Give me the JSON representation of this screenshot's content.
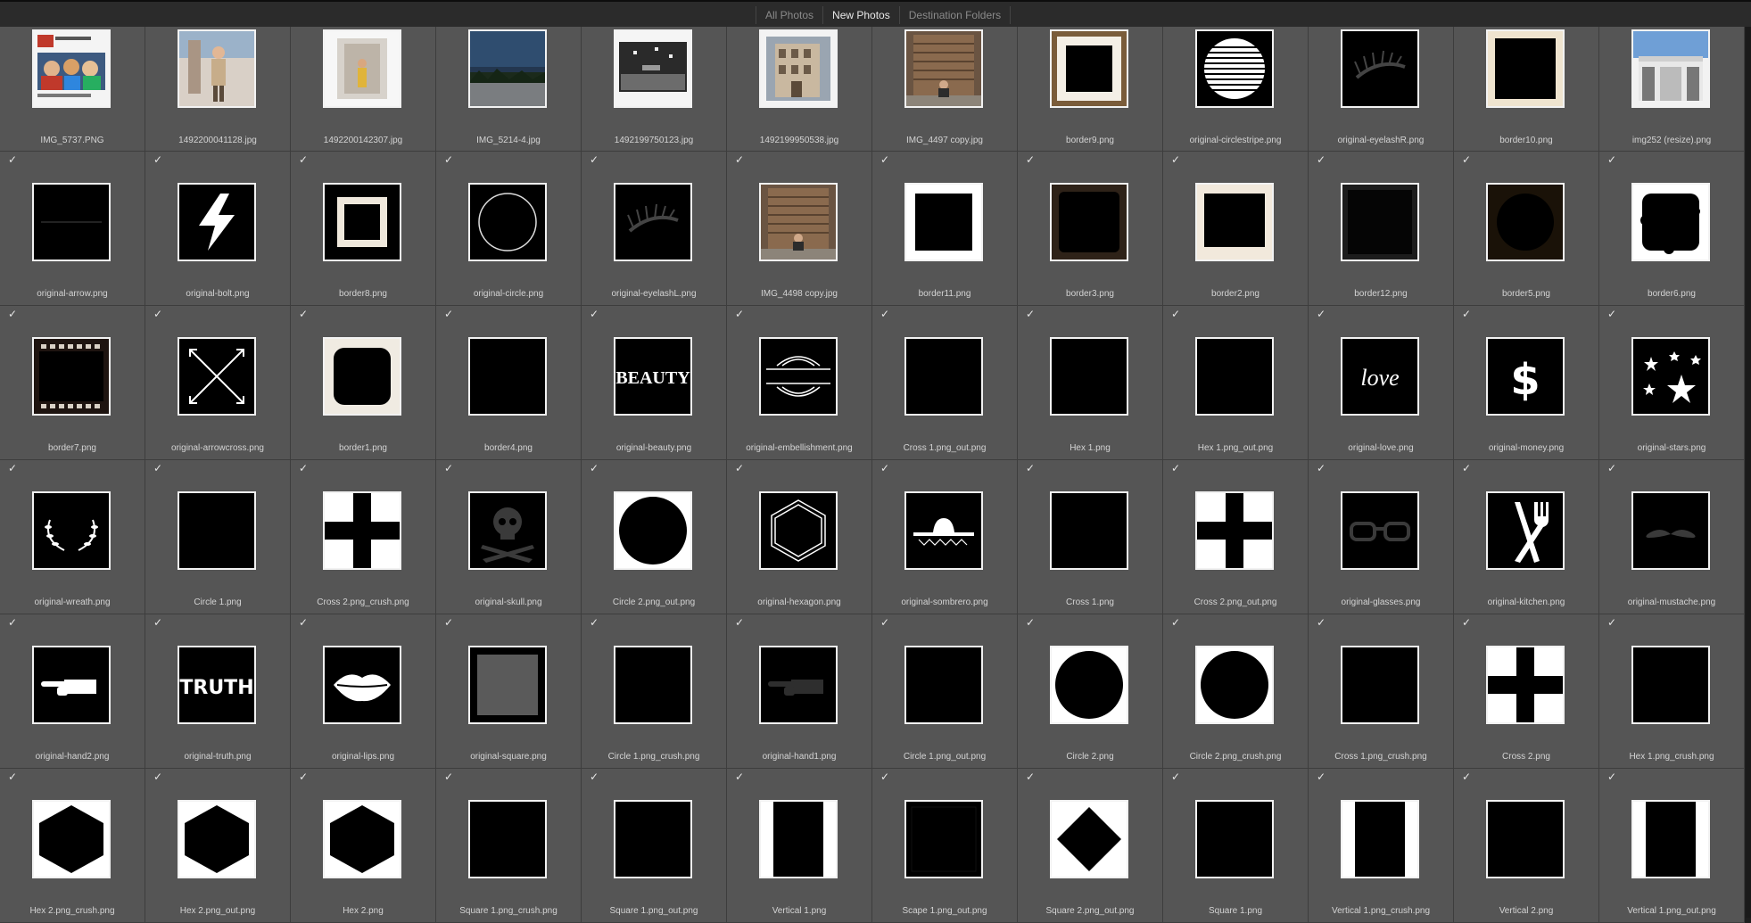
{
  "tabs": [
    "All Photos",
    "New Photos",
    "Destination Folders"
  ],
  "active_tab": "New Photos",
  "rows": [
    {
      "checked": false,
      "items": [
        {
          "name": "IMG_5737.PNG",
          "art": "photo-collage"
        },
        {
          "name": "1492200041128.jpg",
          "art": "photo-person"
        },
        {
          "name": "1492200142307.jpg",
          "art": "photo-door"
        },
        {
          "name": "IMG_5214-4.jpg",
          "art": "photo-landscape"
        },
        {
          "name": "1492199750123.jpg",
          "art": "photo-street"
        },
        {
          "name": "1492199950538.jpg",
          "art": "photo-building"
        },
        {
          "name": "IMG_4497 copy.jpg",
          "art": "photo-wood"
        },
        {
          "name": "border9.png",
          "art": "frame-wood"
        },
        {
          "name": "original-circlestripe.png",
          "art": "circle-stripe"
        },
        {
          "name": "original-eyelashR.png",
          "art": "eyelash"
        },
        {
          "name": "border10.png",
          "art": "frame-cream"
        },
        {
          "name": "img252 (resize).png",
          "art": "photo-building2"
        }
      ]
    },
    {
      "checked": true,
      "items": [
        {
          "name": "original-arrow.png",
          "art": "arrow-line"
        },
        {
          "name": "original-bolt.png",
          "art": "bolt"
        },
        {
          "name": "border8.png",
          "art": "frame-inner-square"
        },
        {
          "name": "original-circle.png",
          "art": "circle-outline"
        },
        {
          "name": "original-eyelashL.png",
          "art": "eyelash"
        },
        {
          "name": "IMG_4498 copy.jpg",
          "art": "photo-wood"
        },
        {
          "name": "border11.png",
          "art": "frame-white-thick"
        },
        {
          "name": "border3.png",
          "art": "frame-dark-brown"
        },
        {
          "name": "border2.png",
          "art": "frame-cream-thin"
        },
        {
          "name": "border12.png",
          "art": "frame-dark-gray"
        },
        {
          "name": "border5.png",
          "art": "frame-burnt"
        },
        {
          "name": "border6.png",
          "art": "frame-grunge"
        }
      ]
    },
    {
      "checked": true,
      "items": [
        {
          "name": "border7.png",
          "art": "frame-film"
        },
        {
          "name": "original-arrowcross.png",
          "art": "arrows-cross"
        },
        {
          "name": "border1.png",
          "art": "frame-rounded"
        },
        {
          "name": "border4.png",
          "art": "black"
        },
        {
          "name": "original-beauty.png",
          "art": "text-beauty"
        },
        {
          "name": "original-embellishment.png",
          "art": "embellishment"
        },
        {
          "name": "Cross 1.png_out.png",
          "art": "black"
        },
        {
          "name": "Hex 1.png",
          "art": "black"
        },
        {
          "name": "Hex 1.png_out.png",
          "art": "black"
        },
        {
          "name": "original-love.png",
          "art": "text-love"
        },
        {
          "name": "original-money.png",
          "art": "money"
        },
        {
          "name": "original-stars.png",
          "art": "stars"
        }
      ]
    },
    {
      "checked": true,
      "items": [
        {
          "name": "original-wreath.png",
          "art": "wreath"
        },
        {
          "name": "Circle 1.png",
          "art": "black"
        },
        {
          "name": "Cross 2.png_crush.png",
          "art": "cross-white"
        },
        {
          "name": "original-skull.png",
          "art": "skull"
        },
        {
          "name": "Circle 2.png_out.png",
          "art": "circle-black"
        },
        {
          "name": "original-hexagon.png",
          "art": "hexagon-outline"
        },
        {
          "name": "original-sombrero.png",
          "art": "sombrero"
        },
        {
          "name": "Cross 1.png",
          "art": "black"
        },
        {
          "name": "Cross 2.png_out.png",
          "art": "cross-white"
        },
        {
          "name": "original-glasses.png",
          "art": "glasses"
        },
        {
          "name": "original-kitchen.png",
          "art": "kitchen"
        },
        {
          "name": "original-mustache.png",
          "art": "mustache"
        }
      ]
    },
    {
      "checked": true,
      "items": [
        {
          "name": "original-hand2.png",
          "art": "hand-white"
        },
        {
          "name": "original-truth.png",
          "art": "text-truth"
        },
        {
          "name": "original-lips.png",
          "art": "lips"
        },
        {
          "name": "original-square.png",
          "art": "square-gray"
        },
        {
          "name": "Circle 1.png_crush.png",
          "art": "black"
        },
        {
          "name": "original-hand1.png",
          "art": "hand-dark"
        },
        {
          "name": "Circle 1.png_out.png",
          "art": "black"
        },
        {
          "name": "Circle 2.png",
          "art": "circle-black"
        },
        {
          "name": "Circle 2.png_crush.png",
          "art": "circle-black"
        },
        {
          "name": "Cross 1.png_crush.png",
          "art": "black"
        },
        {
          "name": "Cross 2.png",
          "art": "cross-white"
        },
        {
          "name": "Hex 1.png_crush.png",
          "art": "black"
        }
      ]
    },
    {
      "checked": true,
      "items": [
        {
          "name": "Hex 2.png_crush.png",
          "art": "hexagon-black"
        },
        {
          "name": "Hex 2.png_out.png",
          "art": "hexagon-black"
        },
        {
          "name": "Hex 2.png",
          "art": "hexagon-black"
        },
        {
          "name": "Square 1.png_crush.png",
          "art": "black"
        },
        {
          "name": "Square 1.png_out.png",
          "art": "black"
        },
        {
          "name": "Vertical 1.png",
          "art": "vertical-bars"
        },
        {
          "name": "Scape 1.png_out.png",
          "art": "black-lined"
        },
        {
          "name": "Square 2.png_out.png",
          "art": "diamond"
        },
        {
          "name": "Square 1.png",
          "art": "black"
        },
        {
          "name": "Vertical 1.png_crush.png",
          "art": "vertical-bars"
        },
        {
          "name": "Vertical 2.png",
          "art": "black"
        },
        {
          "name": "Vertical 1.png_out.png",
          "art": "vertical-bars"
        }
      ]
    }
  ],
  "checkmark_glyph": "✓"
}
